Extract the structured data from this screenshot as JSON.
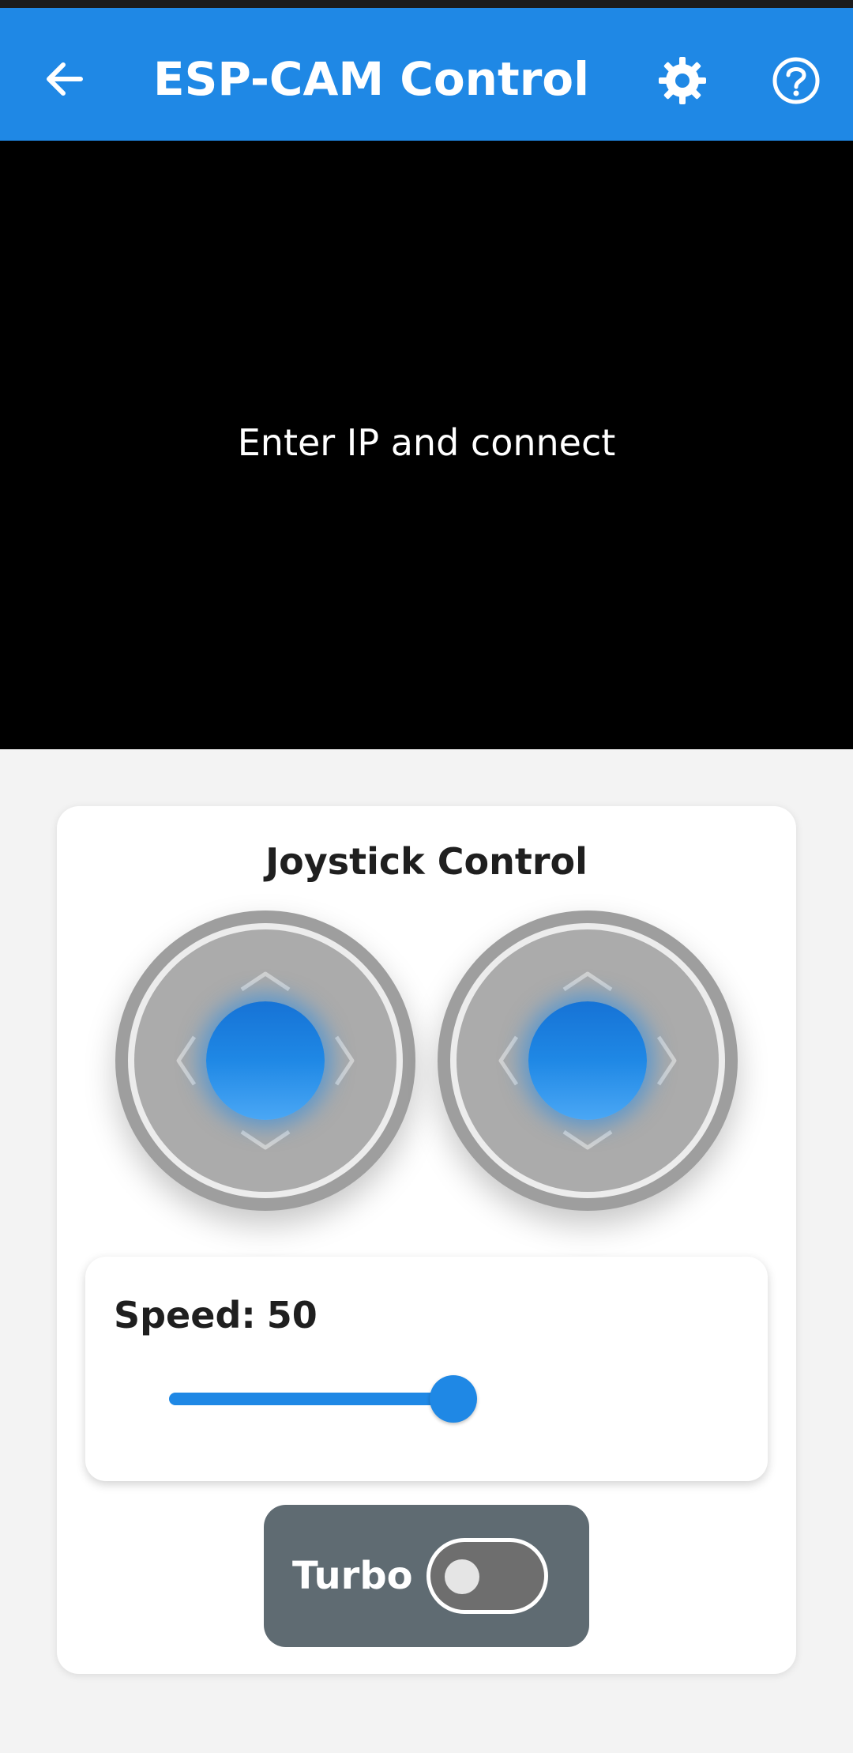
{
  "app_bar": {
    "title": "ESP-CAM Control",
    "back_icon": "arrow-left-icon",
    "settings_icon": "gear-icon",
    "help_icon": "question-circle-icon",
    "color": "#1f88e5"
  },
  "video": {
    "placeholder": "Enter IP and connect"
  },
  "controls": {
    "title": "Joystick Control",
    "joysticks": [
      "left-joystick",
      "right-joystick"
    ],
    "speed": {
      "label": "Speed:",
      "value": "50",
      "fraction": 1.0
    },
    "turbo": {
      "label": "Turbo",
      "enabled": false
    }
  }
}
